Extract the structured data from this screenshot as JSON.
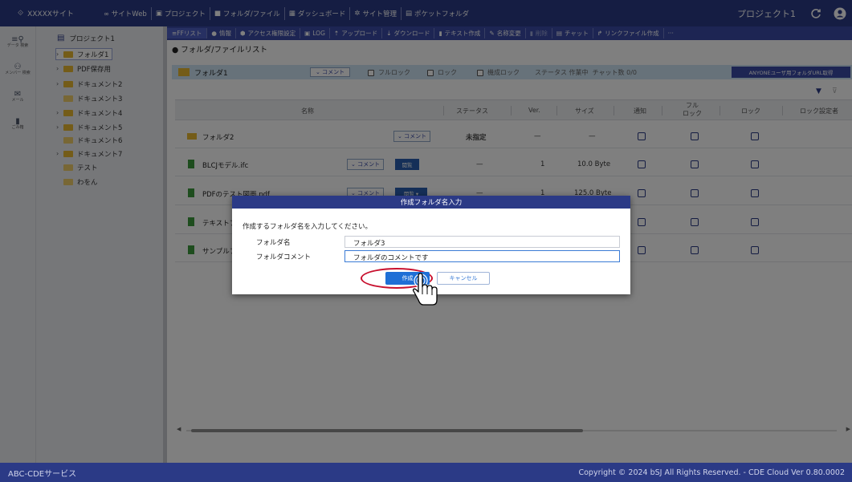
{
  "topbar": {
    "site_name": "XXXXXサイト",
    "nav": [
      "∞ サイトWeb",
      "プロジェクト",
      "フォルダ/ファイル",
      "ダッシュボード",
      "サイト管理",
      "ポケットフォルダ"
    ],
    "project_name": "プロジェクト1"
  },
  "sideicons": [
    {
      "label": "データ 検索",
      "icon": "search-list-icon"
    },
    {
      "label": "メンバー 検索",
      "icon": "member-search-icon"
    },
    {
      "label": "メール",
      "icon": "mail-icon"
    },
    {
      "label": "ごみ箱",
      "icon": "trash-icon"
    }
  ],
  "tree": {
    "root": "プロジェクト1",
    "items": [
      "フォルダ1",
      "PDF保存用",
      "ドキュメント2",
      "ドキュメント3",
      "ドキュメント4",
      "ドキュメント5",
      "ドキュメント6",
      "ドキュメント7",
      "テスト",
      "わをん"
    ]
  },
  "toolbar": [
    "≡FFリスト",
    "情報",
    "アクセス権限設定",
    "LOG",
    "アップロード",
    "ダウンロード",
    "テキスト作成",
    "名称変更",
    "削除",
    "チャット",
    "リンクファイル作成",
    "···"
  ],
  "list_title": "● フォルダ/ファイルリスト",
  "pathbar": {
    "folder": "フォルダ1",
    "comment_btn": "⌄ コメント",
    "full_lock": "フルロック",
    "lock": "ロック",
    "machine_lock": "機成ロック",
    "status_text": "ステータス 作業中",
    "chat_count": "チャット数 0/0",
    "anyone_btn": "ANYONEユーザ用フォルダURL取得"
  },
  "columns": {
    "name": "名称",
    "status": "ステータス",
    "ver": "Ver.",
    "size": "サイズ",
    "notify": "通知",
    "full_lock_top": "フル",
    "full_lock_bottom": "ロック",
    "lock": "ロック",
    "lock_setter": "ロック設定者"
  },
  "rows": [
    {
      "name": "フォルダ2",
      "comment": "⌄ コメント",
      "status": "未指定",
      "ver": "—",
      "size": "—"
    },
    {
      "name": "BLCJモデル.ifc",
      "comment": "⌄ コメント",
      "view": "閲覧",
      "status": "—",
      "ver": "1",
      "size": "10.0 Byte"
    },
    {
      "name": "PDFのテスト図面.pdf",
      "comment": "⌄ コメント",
      "view": "閲覧 ▾",
      "status": "—",
      "ver": "1",
      "size": "125.0 Byte"
    },
    {
      "name": "テキストファイル"
    },
    {
      "name": "サンプルファイル"
    }
  ],
  "dialog": {
    "title": "作成フォルダ名入力",
    "message": "作成するフォルダ名を入力してください。",
    "name_label": "フォルダ名",
    "name_value": "フォルダ3",
    "comment_label": "フォルダコメント",
    "comment_value": "フォルダのコメントです",
    "create": "作成",
    "cancel": "キャンセル"
  },
  "footer": {
    "left": "ABC-CDEサービス",
    "right": "Copyright © 2024 bSJ All Rights Reserved. - CDE Cloud Ver 0.80.0002"
  },
  "colors": {
    "primary": "#2b3a86",
    "folder": "#e8b930",
    "doc": "#3d9a3d",
    "highlight_ring": "#c8102e"
  }
}
